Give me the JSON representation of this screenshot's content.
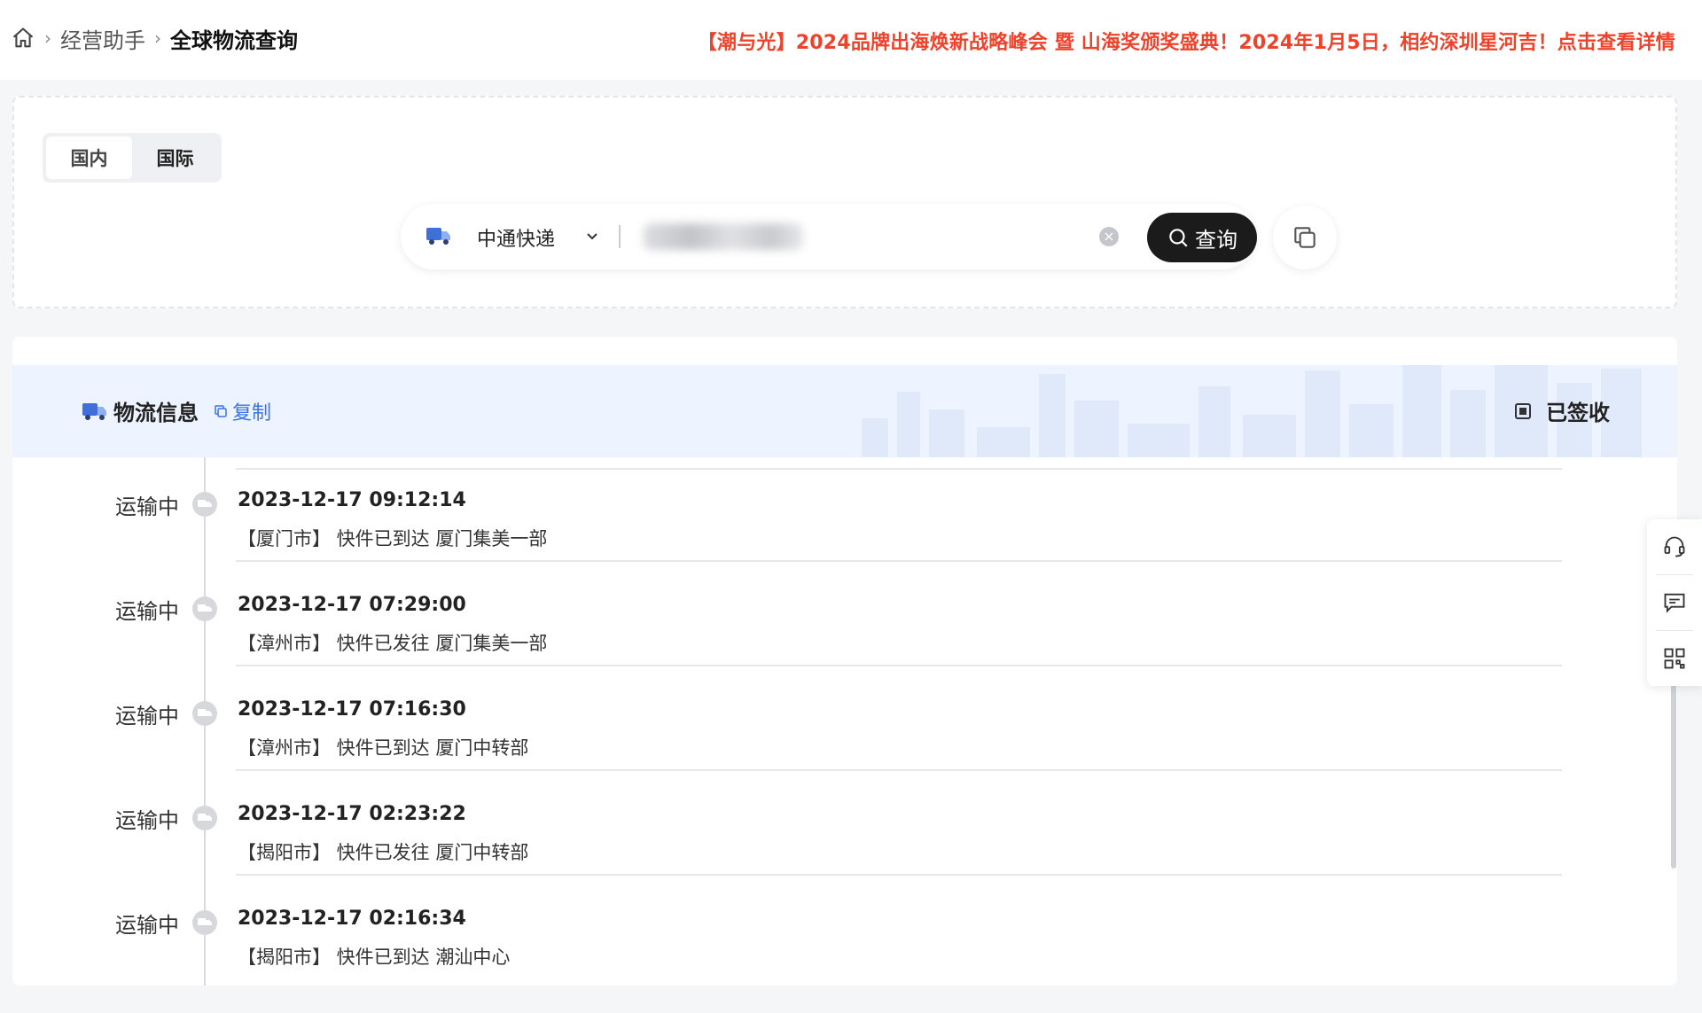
{
  "breadcrumb": {
    "items": [
      "经营助手"
    ],
    "current": "全球物流查询"
  },
  "announcement": "【潮与光】2024品牌出海焕新战略峰会 暨 山海奖颁奖盛典！2024年1月5日，相约深圳星河吉！点击查看详情",
  "tabs": [
    {
      "label": "国内",
      "active": true
    },
    {
      "label": "国际",
      "active": false
    }
  ],
  "search": {
    "carrier": "中通快递",
    "tracking_value": "",
    "query_label": "查询"
  },
  "result": {
    "title": "物流信息",
    "copy_label": "复制",
    "status": "已签收"
  },
  "events": [
    {
      "status": "运输中",
      "time": "2023-12-17 09:12:14",
      "desc": "【厦门市】 快件已到达 厦门集美一部"
    },
    {
      "status": "运输中",
      "time": "2023-12-17 07:29:00",
      "desc": "【漳州市】 快件已发往 厦门集美一部"
    },
    {
      "status": "运输中",
      "time": "2023-12-17 07:16:30",
      "desc": "【漳州市】 快件已到达 厦门中转部"
    },
    {
      "status": "运输中",
      "time": "2023-12-17 02:23:22",
      "desc": "【揭阳市】 快件已发往 厦门中转部"
    },
    {
      "status": "运输中",
      "time": "2023-12-17 02:16:34",
      "desc": "【揭阳市】 快件已到达 潮汕中心"
    }
  ],
  "colors": {
    "accent_red": "#f0412a",
    "link_blue": "#3a73e8",
    "query_button": "#1b1b1b"
  },
  "icons": [
    "home-icon",
    "chevron-right-icon",
    "truck-icon",
    "chevron-down-icon",
    "clear-icon",
    "search-icon",
    "copy-icon",
    "signed-icon",
    "customer-service-icon",
    "feedback-icon",
    "qrcode-icon"
  ]
}
